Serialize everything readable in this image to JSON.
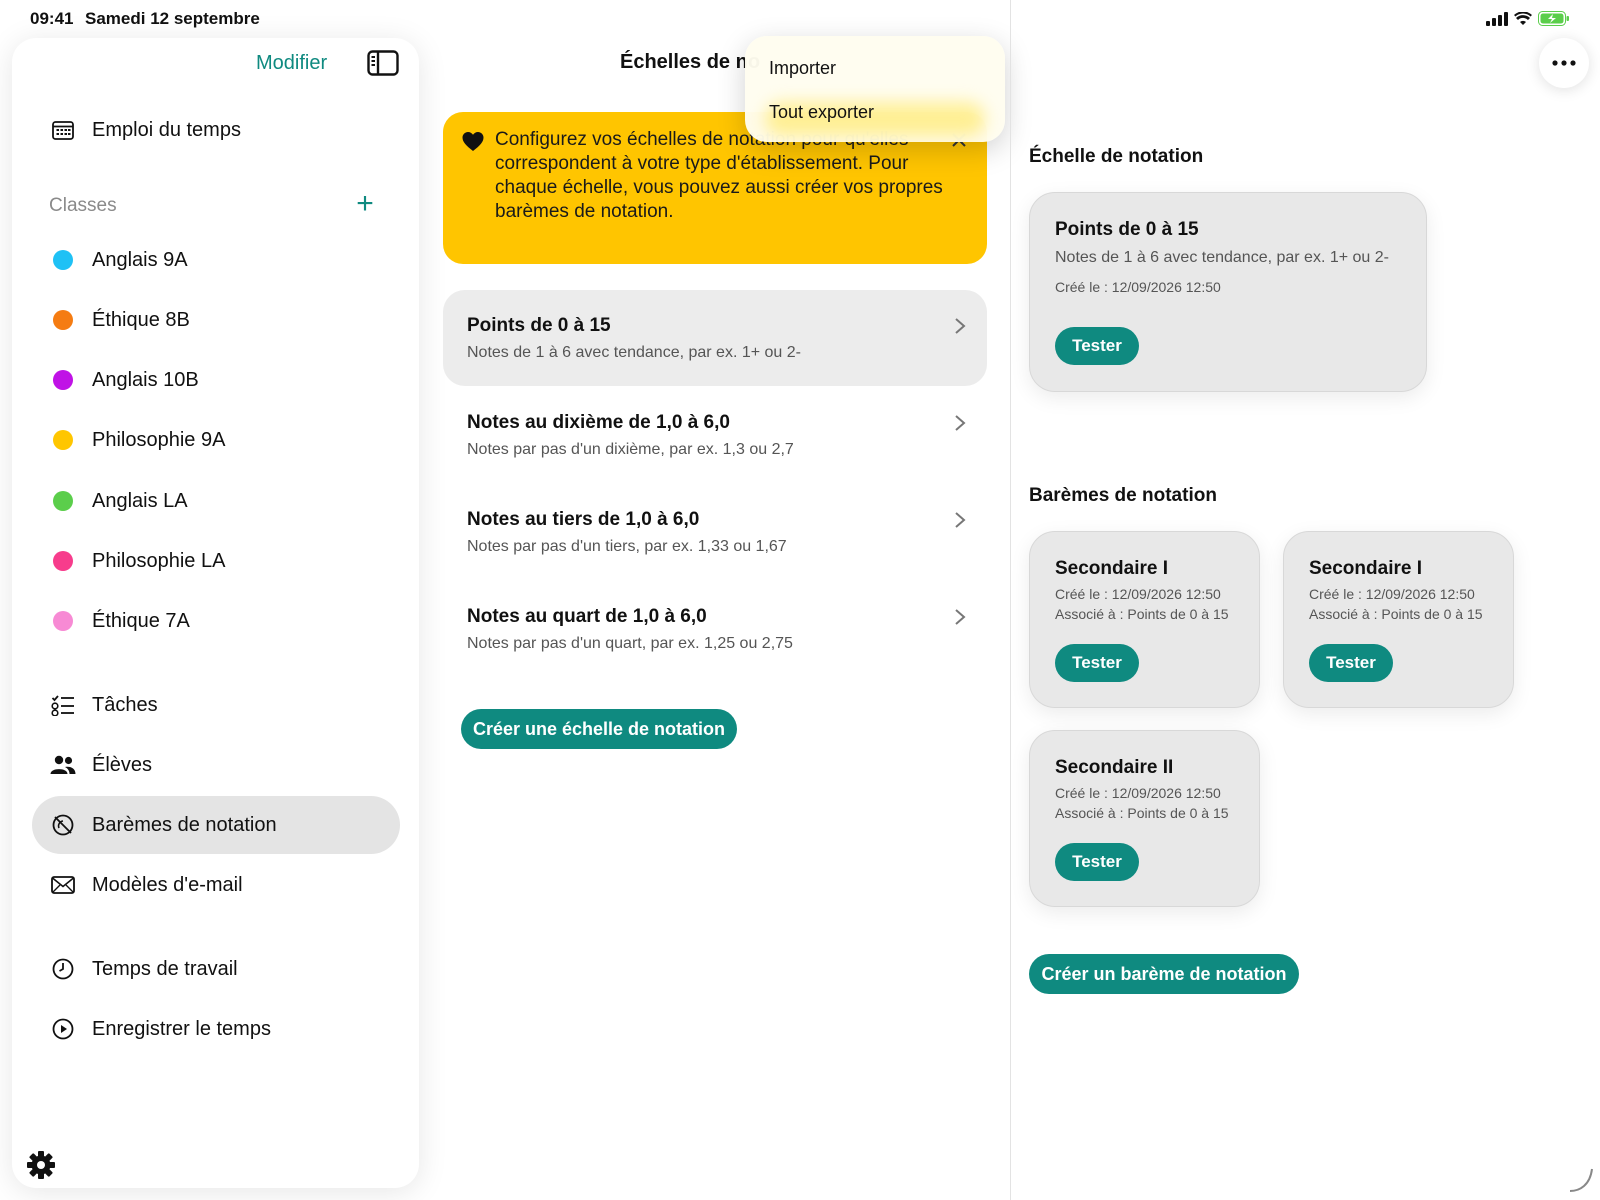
{
  "status_bar": {
    "time": "09:41",
    "date": "Samedi 12 septembre"
  },
  "sidebar": {
    "edit_label": "Modifier",
    "schedule": "Emploi du temps",
    "classes_label": "Classes",
    "classes": [
      {
        "label": "Anglais 9A",
        "color": "#1fc1f5"
      },
      {
        "label": "Éthique 8B",
        "color": "#f57c12"
      },
      {
        "label": "Anglais 10B",
        "color": "#c012e6"
      },
      {
        "label": "Philosophie 9A",
        "color": "#ffc600"
      },
      {
        "label": "Anglais LA",
        "color": "#5bce4b"
      },
      {
        "label": "Philosophie LA",
        "color": "#f73c8c"
      },
      {
        "label": "Éthique 7A",
        "color": "#f78ad4"
      }
    ],
    "items": [
      {
        "label": "Tâches",
        "icon": "checklist-icon"
      },
      {
        "label": "Élèves",
        "icon": "people-icon"
      },
      {
        "label": "Barèmes de notation",
        "icon": "gauge-icon",
        "selected": true
      },
      {
        "label": "Modèles d'e-mail",
        "icon": "envelope-icon"
      },
      {
        "label": "Temps de travail",
        "icon": "clock-icon"
      },
      {
        "label": "Enregistrer le temps",
        "icon": "play-circle-icon"
      }
    ]
  },
  "middle": {
    "title": "Échelles de no",
    "banner": "Configurez vos échelles de notation pour qu'elles correspondent à votre type d'établissement. Pour chaque échelle, vous pouvez aussi créer vos propres barèmes de notation.",
    "scales": [
      {
        "title": "Points de 0 à 15",
        "subtitle": "Notes de 1 à 6 avec tendance, par ex. 1+ ou 2-",
        "selected": true
      },
      {
        "title": "Notes au dixième de 1,0 à 6,0",
        "subtitle": "Notes par pas d'un dixième, par ex. 1,3 ou 2,7"
      },
      {
        "title": "Notes au tiers de 1,0 à 6,0",
        "subtitle": "Notes par pas d'un tiers, par ex. 1,33 ou 1,67"
      },
      {
        "title": "Notes au quart de 1,0 à 6,0",
        "subtitle": "Notes par pas d'un quart, par ex. 1,25 ou 2,75"
      }
    ],
    "create_button": "Créer une échelle de notation"
  },
  "menu": {
    "import": "Importer",
    "export_all": "Tout exporter"
  },
  "detail": {
    "scale_heading": "Échelle de notation",
    "scale_card": {
      "title": "Points de 0 à 15",
      "subtitle": "Notes de 1 à 6 avec tendance, par ex. 1+ ou 2-",
      "created": "Créé le : 12/09/2026 12:50",
      "test_button": "Tester"
    },
    "schemes_heading": "Barèmes de notation",
    "schemes": [
      {
        "title": "Secondaire I",
        "created": "Créé le : 12/09/2026 12:50",
        "associated": "Associé à : Points de 0 à 15",
        "test_button": "Tester"
      },
      {
        "title": "Secondaire I",
        "created": "Créé le : 12/09/2026 12:50",
        "associated": "Associé à : Points de 0 à 15",
        "test_button": "Tester"
      },
      {
        "title": "Secondaire II",
        "created": "Créé le : 12/09/2026 12:50",
        "associated": "Associé à : Points de 0 à 15",
        "test_button": "Tester"
      }
    ],
    "create_button": "Créer un barème de notation"
  },
  "colors": {
    "accent": "#0f8a80",
    "banner": "#ffc500",
    "selected": "#e4e4e4"
  }
}
